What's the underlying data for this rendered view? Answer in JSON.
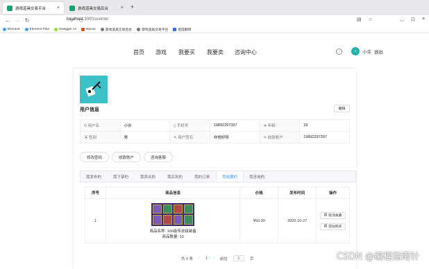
{
  "browser": {
    "tabs": [
      {
        "title": "游戏道具交易平台",
        "active": true,
        "color": "#1f9e6e"
      },
      {
        "title": "游戏道具交易后台",
        "active": false,
        "color": "#1f9e6e"
      }
    ],
    "new_tab": "+",
    "url_host": "localhost",
    "url_path": ":3000/ucenter",
    "bookmarks": [
      {
        "label": "Element",
        "color": "#409eff"
      },
      {
        "label": "Element Plus",
        "color": "#409eff"
      },
      {
        "label": "Swagger UI",
        "color": "#85ea2d"
      },
      {
        "label": "Nacos",
        "color": "#e34b2c"
      },
      {
        "label": "游戏道具交易后台",
        "color": "#777"
      },
      {
        "label": "游戏道具交易平台",
        "color": "#777"
      },
      {
        "label": "百度翻译",
        "color": "#2b6df0"
      }
    ]
  },
  "site": {
    "menu": [
      "首页",
      "游戏",
      "我要买",
      "我要卖",
      "咨询中心"
    ],
    "user_name": "小许",
    "logout": "退出"
  },
  "profile": {
    "title": "用户信息",
    "edit_label": "编辑",
    "fields": [
      [
        {
          "label": "用户名",
          "value": "小许"
        },
        {
          "label": "手机号",
          "value": "19892297397"
        },
        {
          "label": "年龄",
          "value": "18"
        }
      ],
      [
        {
          "label": "性别",
          "value": "男"
        },
        {
          "label": "用户签名",
          "value": "非常好呀"
        },
        {
          "label": "收款账户",
          "value": "19892297397"
        }
      ]
    ],
    "actions": [
      "修改密码",
      "收款账户",
      "咨询客服"
    ]
  },
  "tabs": {
    "items": [
      "我发布的",
      "我下架的",
      "我卖出的",
      "我买到的",
      "我的订单",
      "我收藏的",
      "我咨询的"
    ],
    "active_index": 5
  },
  "orders": {
    "columns": [
      "序号",
      "商品信息",
      "价格",
      "发布时间",
      "操作"
    ],
    "rows": [
      {
        "index": "1",
        "name_line": "商品名称: 166级传说级装备",
        "qty_line": "商品数量: 10",
        "price": "¥50.00",
        "date": "2022-10-27",
        "actions": [
          "取消收藏",
          "前往购买"
        ]
      }
    ]
  },
  "pager": {
    "total": "共 0 条",
    "prev": "‹",
    "current": "1",
    "next": "›",
    "goto_label": "前往",
    "goto_value": "1",
    "page_suffix": "页"
  },
  "watermark": "CSDN @编程指南针"
}
